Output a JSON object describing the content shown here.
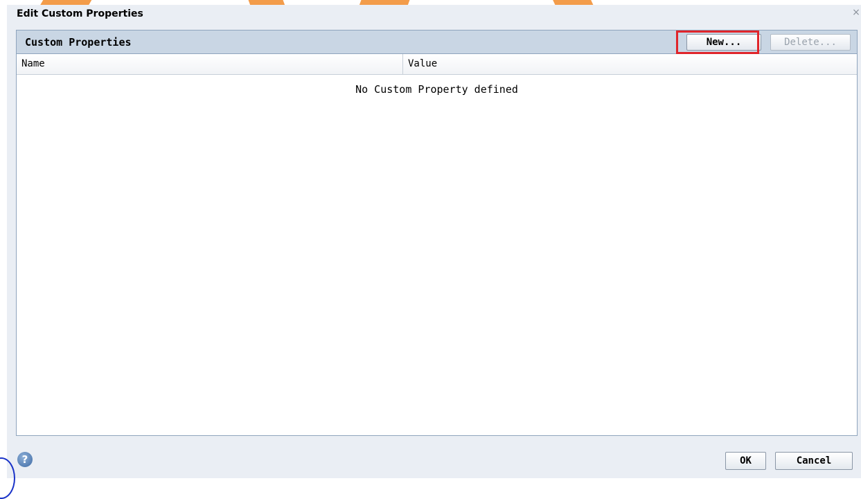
{
  "dialog": {
    "title": "Edit Custom Properties",
    "close_glyph": "×"
  },
  "panel": {
    "title": "Custom Properties",
    "new_label": "New...",
    "delete_label": "Delete...",
    "columns": [
      "Name",
      "Value"
    ],
    "empty_message": "No Custom Property defined"
  },
  "footer": {
    "help_glyph": "?",
    "ok_label": "OK",
    "cancel_label": "Cancel"
  },
  "colors": {
    "accent_highlight": "#e0252b",
    "panel_header": "#c9d6e4",
    "dialog_background": "#eaeef4",
    "watermark": "#f39c4a"
  },
  "icons": {
    "close": "close-icon",
    "help": "help-icon"
  }
}
